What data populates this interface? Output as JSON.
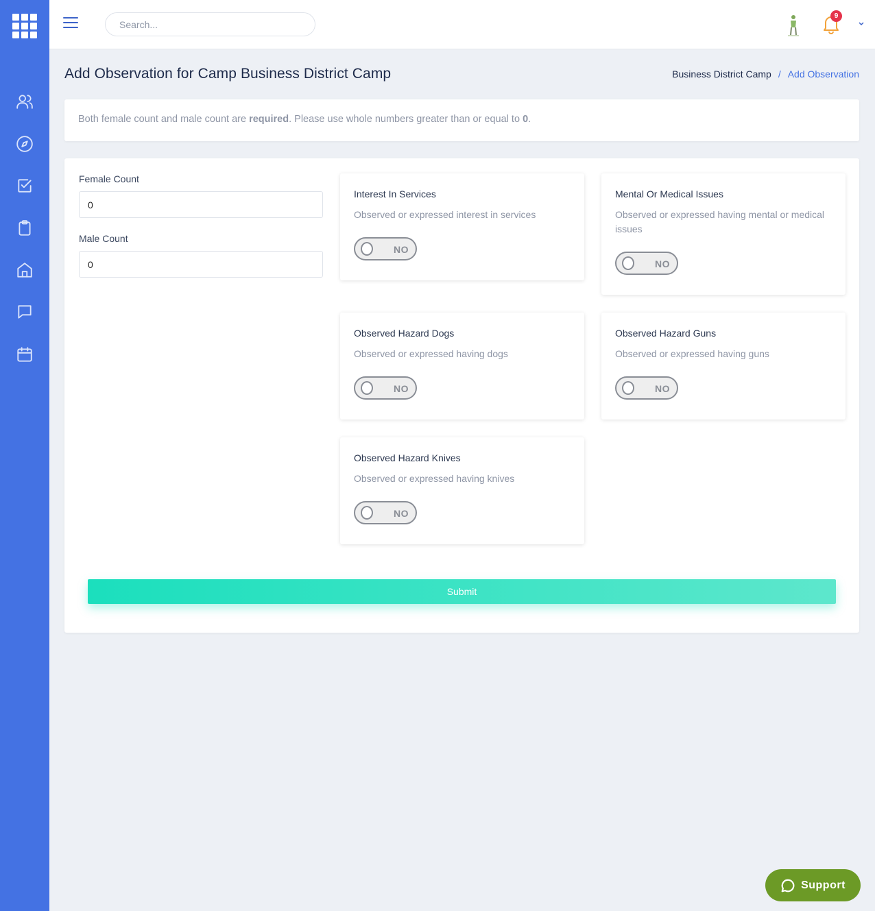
{
  "header": {
    "search_placeholder": "Search...",
    "notification_count": "9"
  },
  "page": {
    "title": "Add Observation for Camp Business District Camp",
    "breadcrumb": {
      "parent": "Business District Camp",
      "separator": "/",
      "current": "Add Observation"
    }
  },
  "info": {
    "prefix": "Both female count and male count are ",
    "bold1": "required",
    "middle": ". Please use whole numbers greater than or equal to ",
    "bold2": "0",
    "suffix": "."
  },
  "form": {
    "female_label": "Female Count",
    "female_value": "0",
    "male_label": "Male Count",
    "male_value": "0",
    "submit_label": "Submit"
  },
  "observations": [
    {
      "title": "Interest In Services",
      "desc": "Observed or expressed interest in services",
      "toggle": "NO"
    },
    {
      "title": "Mental Or Medical Issues",
      "desc": "Observed or expressed having mental or medical issues",
      "toggle": "NO"
    },
    {
      "title": "Observed Hazard Dogs",
      "desc": "Observed or expressed having dogs",
      "toggle": "NO"
    },
    {
      "title": "Observed Hazard Guns",
      "desc": "Observed or expressed having guns",
      "toggle": "NO"
    },
    {
      "title": "Observed Hazard Knives",
      "desc": "Observed or expressed having knives",
      "toggle": "NO"
    }
  ],
  "support_label": "Support",
  "colors": {
    "sidebar": "#4472e3",
    "accent": "#4472e3",
    "submit": "#1bdfbd",
    "support": "#6c9a26",
    "badge": "#e5334b"
  },
  "icons": {
    "sidebar": [
      "users-icon",
      "compass-icon",
      "check-square-icon",
      "clipboard-icon",
      "home-icon",
      "message-icon",
      "calendar-icon"
    ]
  }
}
